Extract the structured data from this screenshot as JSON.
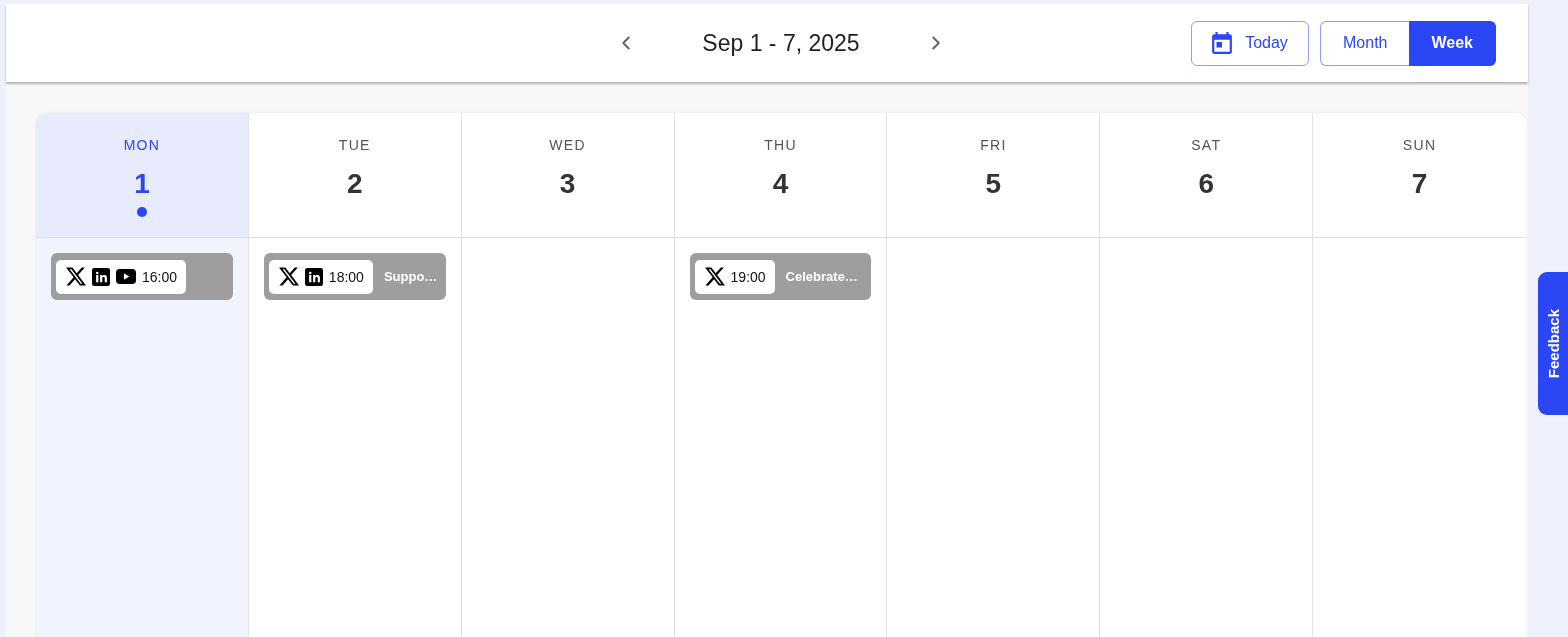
{
  "header": {
    "title": "Sep 1 - 7, 2025",
    "today_button": "Today",
    "views": [
      {
        "label": "Month",
        "selected": false
      },
      {
        "label": "Week",
        "selected": true
      }
    ]
  },
  "days": [
    {
      "name": "MON",
      "date": "1",
      "today": true,
      "events": [
        {
          "platforms": [
            {
              "kind": "x"
            },
            {
              "kind": "linkedin"
            },
            {
              "kind": "youtube"
            }
          ],
          "time": "16:00"
        }
      ]
    },
    {
      "name": "TUE",
      "date": "2",
      "today": false,
      "events": [
        {
          "platforms": [
            {
              "kind": "x"
            },
            {
              "kind": "linkedin"
            }
          ],
          "time": "18:00",
          "title": "Suppo…"
        }
      ]
    },
    {
      "name": "WED",
      "date": "3",
      "today": false
    },
    {
      "name": "THU",
      "date": "4",
      "today": false,
      "events": [
        {
          "platforms": [
            {
              "kind": "x"
            }
          ],
          "time": "19:00",
          "title": "Celebrate…"
        }
      ]
    },
    {
      "name": "FRI",
      "date": "5",
      "today": false
    },
    {
      "name": "SAT",
      "date": "6",
      "today": false
    },
    {
      "name": "SUN",
      "date": "7",
      "today": false
    }
  ],
  "feedback_tab": {
    "label": "Feedback"
  }
}
